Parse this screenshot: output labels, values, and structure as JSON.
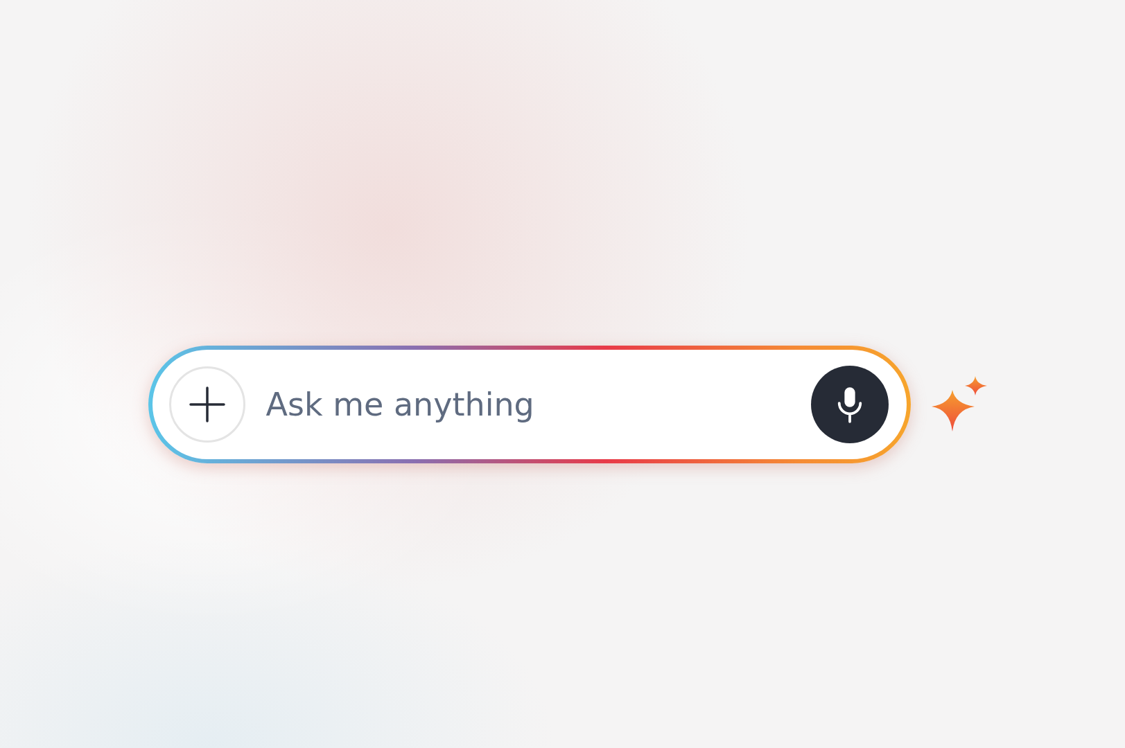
{
  "search": {
    "placeholder": "Ask me anything"
  }
}
